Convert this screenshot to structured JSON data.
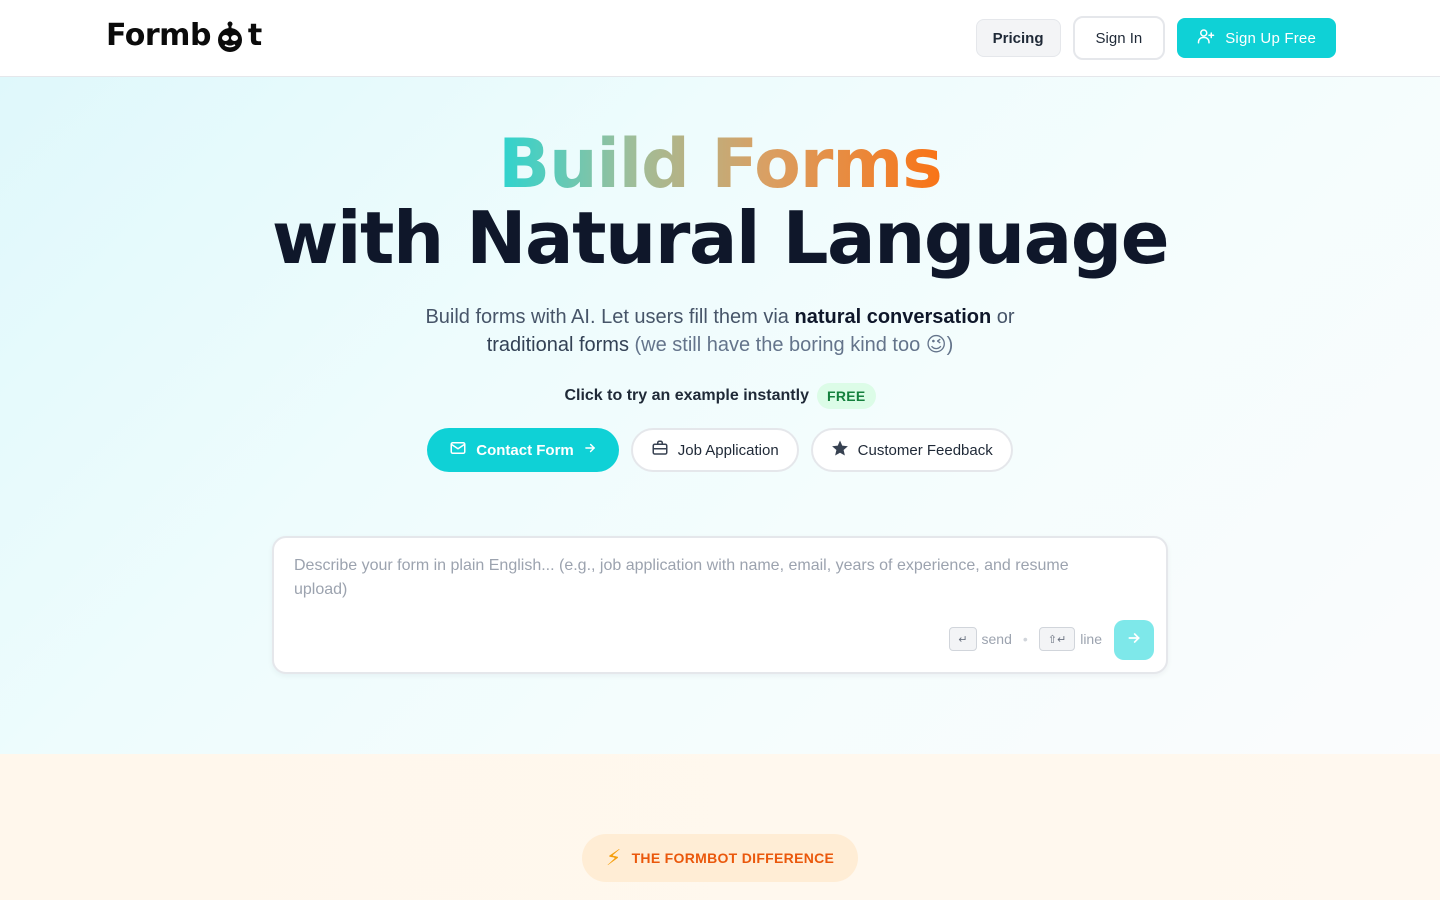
{
  "header": {
    "logo_text": "Formb",
    "logo_suffix": "t",
    "pricing_label": "Pricing",
    "signin_label": "Sign In",
    "signup_label": "Sign Up Free"
  },
  "hero": {
    "title_line1": "Build Forms",
    "title_line2": "with Natural Language",
    "subtitle_part1": "Build forms with AI. Let users fill them via ",
    "subtitle_bold": "natural conversation",
    "subtitle_part2": " or",
    "subtitle_dark": "traditional forms",
    "subtitle_muted": " (we still have the boring kind too 😉)",
    "try_label": "Click to try an example instantly",
    "free_badge": "FREE",
    "examples": [
      {
        "label": "Contact Form",
        "icon": "mail-icon"
      },
      {
        "label": "Job Application",
        "icon": "briefcase-icon"
      },
      {
        "label": "Customer Feedback",
        "icon": "star-icon"
      }
    ]
  },
  "composer": {
    "placeholder": "Describe your form in plain English... (e.g., job application with name, email, years of experience, and resume upload)",
    "send_key": "↵",
    "send_hint": "send",
    "newline_key": "⇧↵",
    "newline_hint": "line"
  },
  "section": {
    "badge_icon": "⚡",
    "badge_label": "THE FORMBOT DIFFERENCE"
  },
  "colors": {
    "accent": "#0fd1d6",
    "text_dark": "#0f172a",
    "badge_orange": "#ea580c",
    "free_green": "#15803d"
  }
}
